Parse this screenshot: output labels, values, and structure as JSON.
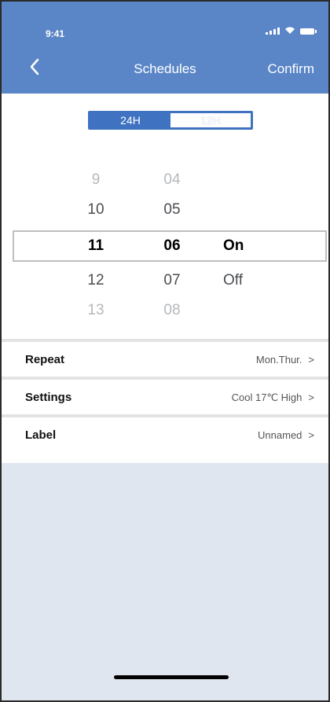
{
  "status_bar": {
    "time": "9:41"
  },
  "header": {
    "title": "Schedules",
    "confirm_label": "Confirm",
    "back_icon": "chevron-left-icon"
  },
  "mode_toggle": {
    "options": [
      "24H",
      "12H"
    ],
    "selected": "12H"
  },
  "picker": {
    "hours": [
      "9",
      "10",
      "11",
      "12",
      "13"
    ],
    "minutes": [
      "04",
      "05",
      "06",
      "07",
      "08"
    ],
    "states": [
      "On",
      "Off"
    ],
    "selected_hour": "11",
    "selected_minute": "06",
    "selected_state": "On"
  },
  "settings": [
    {
      "label": "Repeat",
      "value": "Mon.Thur."
    },
    {
      "label": "Settings",
      "value": "Cool 17℃ High"
    },
    {
      "label": "Label",
      "value": "Unnamed"
    }
  ],
  "colors": {
    "header_bg": "#5a86c7",
    "toggle_bg": "#3f73c1",
    "page_bg": "#dfe6ef"
  }
}
